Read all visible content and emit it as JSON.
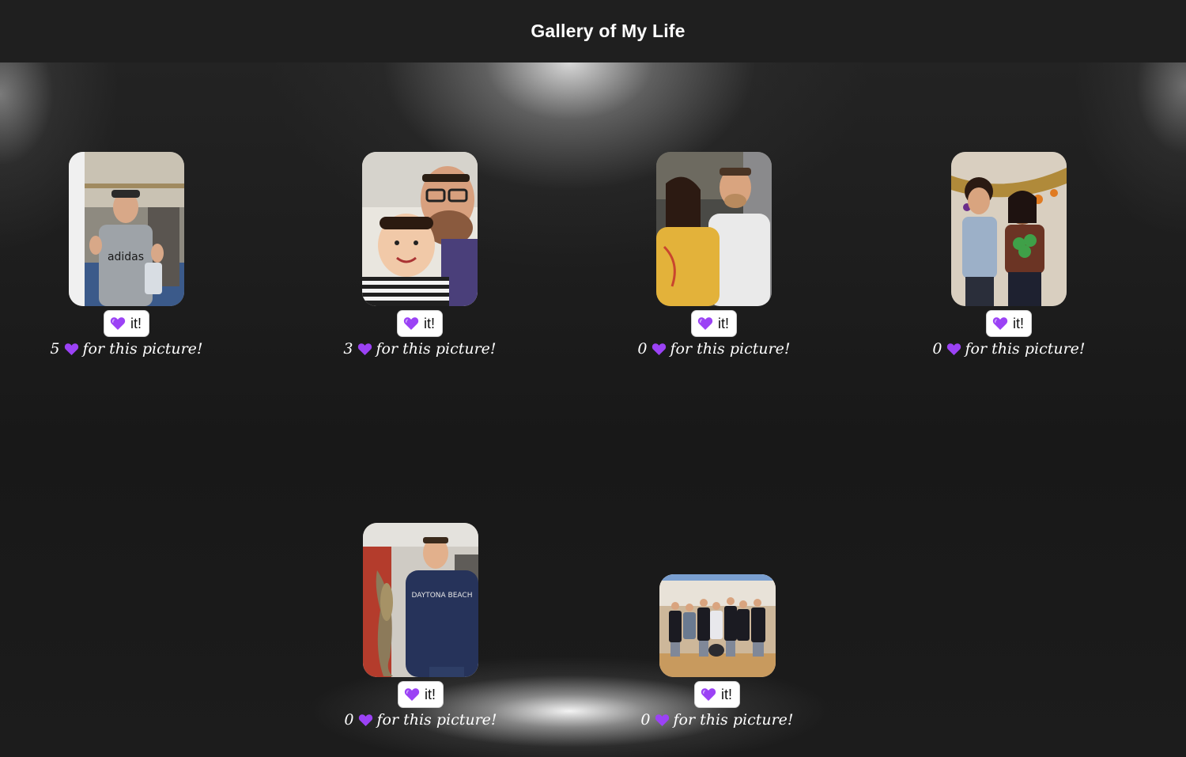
{
  "header": {
    "title": "Gallery of My Life"
  },
  "love_button_label": "it!",
  "icons": {
    "heart": "purple-heart-icon",
    "heart_color": "#9b42f5"
  },
  "gallery": [
    {
      "count": "5",
      "suffix": "for this picture!",
      "photo_alt": "man-with-thumbs-up-photo"
    },
    {
      "count": "3",
      "suffix": "for this picture!",
      "photo_alt": "man-with-toddler-photo"
    },
    {
      "count": "0",
      "suffix": "for this picture!",
      "photo_alt": "couple-laughing-photo"
    },
    {
      "count": "0",
      "suffix": "for this picture!",
      "photo_alt": "couple-halloween-photo"
    },
    {
      "count": "0",
      "suffix": "for this picture!",
      "photo_alt": "man-holding-fish-photo"
    },
    {
      "count": "0",
      "suffix": "for this picture!",
      "photo_alt": "basketball-team-photo"
    }
  ]
}
